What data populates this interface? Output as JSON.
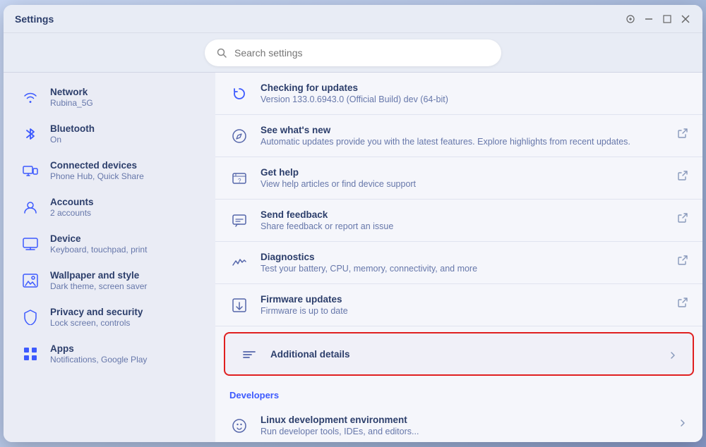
{
  "window": {
    "title": "Settings",
    "controls": {
      "zoom": "⊕",
      "minimize": "—",
      "maximize": "⬜",
      "close": "✕"
    }
  },
  "search": {
    "placeholder": "Search settings"
  },
  "sidebar": {
    "items": [
      {
        "id": "network",
        "label": "Network",
        "sublabel": "Rubina_5G",
        "icon": "wifi"
      },
      {
        "id": "bluetooth",
        "label": "Bluetooth",
        "sublabel": "On",
        "icon": "bluetooth"
      },
      {
        "id": "connected-devices",
        "label": "Connected devices",
        "sublabel": "Phone Hub, Quick Share",
        "icon": "devices"
      },
      {
        "id": "accounts",
        "label": "Accounts",
        "sublabel": "2 accounts",
        "icon": "account"
      },
      {
        "id": "device",
        "label": "Device",
        "sublabel": "Keyboard, touchpad, print",
        "icon": "device"
      },
      {
        "id": "wallpaper",
        "label": "Wallpaper and style",
        "sublabel": "Dark theme, screen saver",
        "icon": "wallpaper"
      },
      {
        "id": "privacy",
        "label": "Privacy and security",
        "sublabel": "Lock screen, controls",
        "icon": "privacy"
      },
      {
        "id": "apps",
        "label": "Apps",
        "sublabel": "Notifications, Google Play",
        "icon": "apps"
      }
    ]
  },
  "panel": {
    "items": [
      {
        "id": "checking-updates",
        "icon": "update",
        "title": "Checking for updates",
        "desc": "Version 133.0.6943.0 (Official Build) dev (64-bit)",
        "hasArrow": false
      },
      {
        "id": "see-whats-new",
        "icon": "compass",
        "title": "See what's new",
        "desc": "Automatic updates provide you with the latest features. Explore highlights from recent updates.",
        "hasArrow": true
      },
      {
        "id": "get-help",
        "icon": "help",
        "title": "Get help",
        "desc": "View help articles or find device support",
        "hasArrow": true
      },
      {
        "id": "send-feedback",
        "icon": "feedback",
        "title": "Send feedback",
        "desc": "Share feedback or report an issue",
        "hasArrow": true
      },
      {
        "id": "diagnostics",
        "icon": "diagnostics",
        "title": "Diagnostics",
        "desc": "Test your battery, CPU, memory, connectivity, and more",
        "hasArrow": true
      },
      {
        "id": "firmware-updates",
        "icon": "firmware",
        "title": "Firmware updates",
        "desc": "Firmware is up to date",
        "hasArrow": true
      }
    ],
    "highlighted": {
      "id": "additional-details",
      "icon": "list",
      "title": "Additional details",
      "hasArrow": true
    },
    "section_developers": "Developers",
    "developers_items": [
      {
        "id": "linux-env",
        "icon": "linux",
        "title": "Linux development environment",
        "desc": "Run developer tools, IDEs, and editors...",
        "hasArrow": true
      }
    ]
  },
  "icons": {
    "wifi": "📶",
    "bluetooth": "⚡",
    "devices": "📱",
    "account": "😊",
    "device": "💻",
    "wallpaper": "🎨",
    "privacy": "🔒",
    "apps": "⋮⋮",
    "update": "↻",
    "compass": "🧭",
    "help": "?",
    "feedback": "💬",
    "diagnostics": "📈",
    "firmware": "⬇",
    "list": "≡",
    "linux": "🐧",
    "search": "🔍",
    "external": "↗",
    "chevron": "›",
    "minimize": "—",
    "maximize": "⬜",
    "close": "✕",
    "zoom": "⊕"
  }
}
